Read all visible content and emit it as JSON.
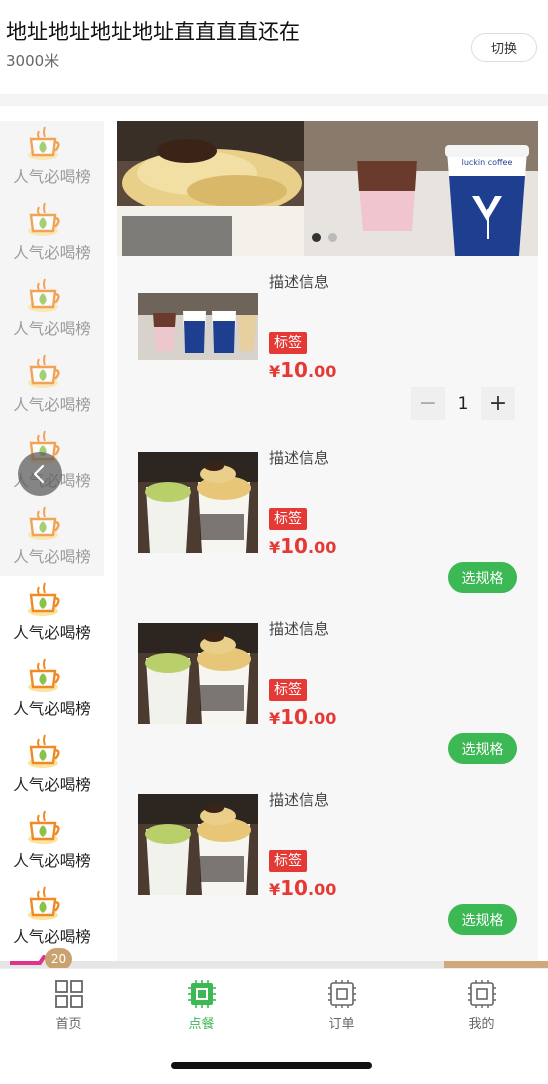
{
  "header": {
    "address": "地址地址地址地址直直直直还在",
    "distance": "3000米",
    "switch_label": "切换"
  },
  "sidebar": {
    "items": [
      {
        "label": "人气必喝榜"
      },
      {
        "label": "人气必喝榜"
      },
      {
        "label": "人气必喝榜"
      },
      {
        "label": "人气必喝榜"
      },
      {
        "label": "人气必喝榜"
      },
      {
        "label": "人气必喝榜"
      },
      {
        "label": "人气必喝榜"
      },
      {
        "label": "人气必喝榜"
      },
      {
        "label": "人气必喝榜"
      },
      {
        "label": "人气必喝榜"
      },
      {
        "label": "人气必喝榜"
      }
    ]
  },
  "banner": {
    "slides": 2,
    "active_slide": 1,
    "cup_text": "luckin coffee"
  },
  "products": [
    {
      "desc": "描述信息",
      "tag": "标签",
      "currency": "¥",
      "price_int": "10",
      "price_dec": ".00",
      "quantity": "1"
    },
    {
      "desc": "描述信息",
      "tag": "标签",
      "currency": "¥",
      "price_int": "10",
      "price_dec": ".00",
      "action": "选规格"
    },
    {
      "desc": "描述信息",
      "tag": "标签",
      "currency": "¥",
      "price_int": "10",
      "price_dec": ".00",
      "action": "选规格"
    },
    {
      "desc": "描述信息",
      "tag": "标签",
      "currency": "¥",
      "price_int": "10",
      "price_dec": ".00",
      "action": "选规格"
    }
  ],
  "cart": {
    "count": "20"
  },
  "tabs": [
    {
      "label": "首页",
      "icon": "grid-icon"
    },
    {
      "label": "点餐",
      "icon": "chip-icon"
    },
    {
      "label": "订单",
      "icon": "chip-icon"
    },
    {
      "label": "我的",
      "icon": "chip-icon"
    }
  ],
  "colors": {
    "accent_green": "#3cb854",
    "price_red": "#e53935",
    "badge_tan": "#c9a26f"
  }
}
